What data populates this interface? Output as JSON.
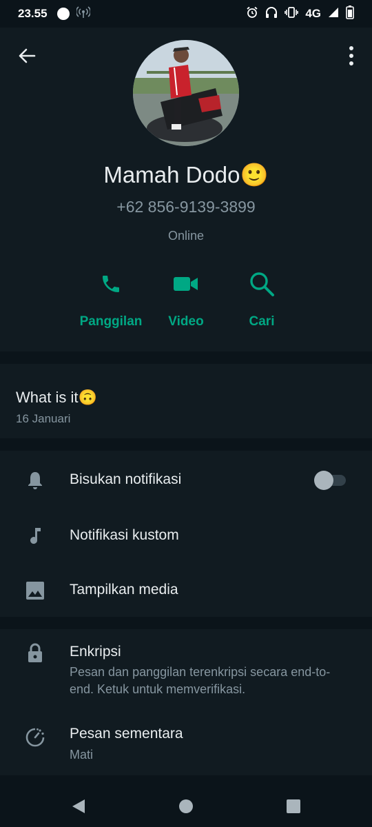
{
  "status_bar": {
    "time": "23.55",
    "network": "4G",
    "icons": [
      "circle-icon",
      "hotspot-icon",
      "alarm-icon",
      "headphones-icon",
      "vibrate-icon",
      "signal-icon",
      "battery-icon"
    ]
  },
  "header": {
    "back_icon": "arrow-back-icon",
    "menu_icon": "more-vert-icon"
  },
  "contact": {
    "name": "Mamah Dodo🙂",
    "phone": "+62 856-9139-3899",
    "status": "Online"
  },
  "actions": [
    {
      "label": "Panggilan",
      "icon": "phone-icon"
    },
    {
      "label": "Video",
      "icon": "video-icon"
    },
    {
      "label": "Cari",
      "icon": "search-icon"
    }
  ],
  "about": {
    "text": "What is it🙃",
    "date": "16 Januari"
  },
  "settings": [
    {
      "title": "Bisukan notifikasi",
      "icon": "bell-icon",
      "toggle": false
    },
    {
      "title": "Notifikasi kustom",
      "icon": "music-note-icon"
    },
    {
      "title": "Tampilkan media",
      "icon": "image-icon"
    }
  ],
  "privacy": [
    {
      "title": "Enkripsi",
      "subtitle": "Pesan dan panggilan terenkripsi secara end-to-end. Ketuk untuk memverifikasi.",
      "icon": "lock-icon"
    },
    {
      "title": "Pesan sementara",
      "subtitle": "Mati",
      "icon": "timer-icon"
    }
  ],
  "colors": {
    "accent": "#00a884",
    "background": "#0b141a",
    "panel": "#111b21",
    "secondary_text": "#8696a0"
  }
}
